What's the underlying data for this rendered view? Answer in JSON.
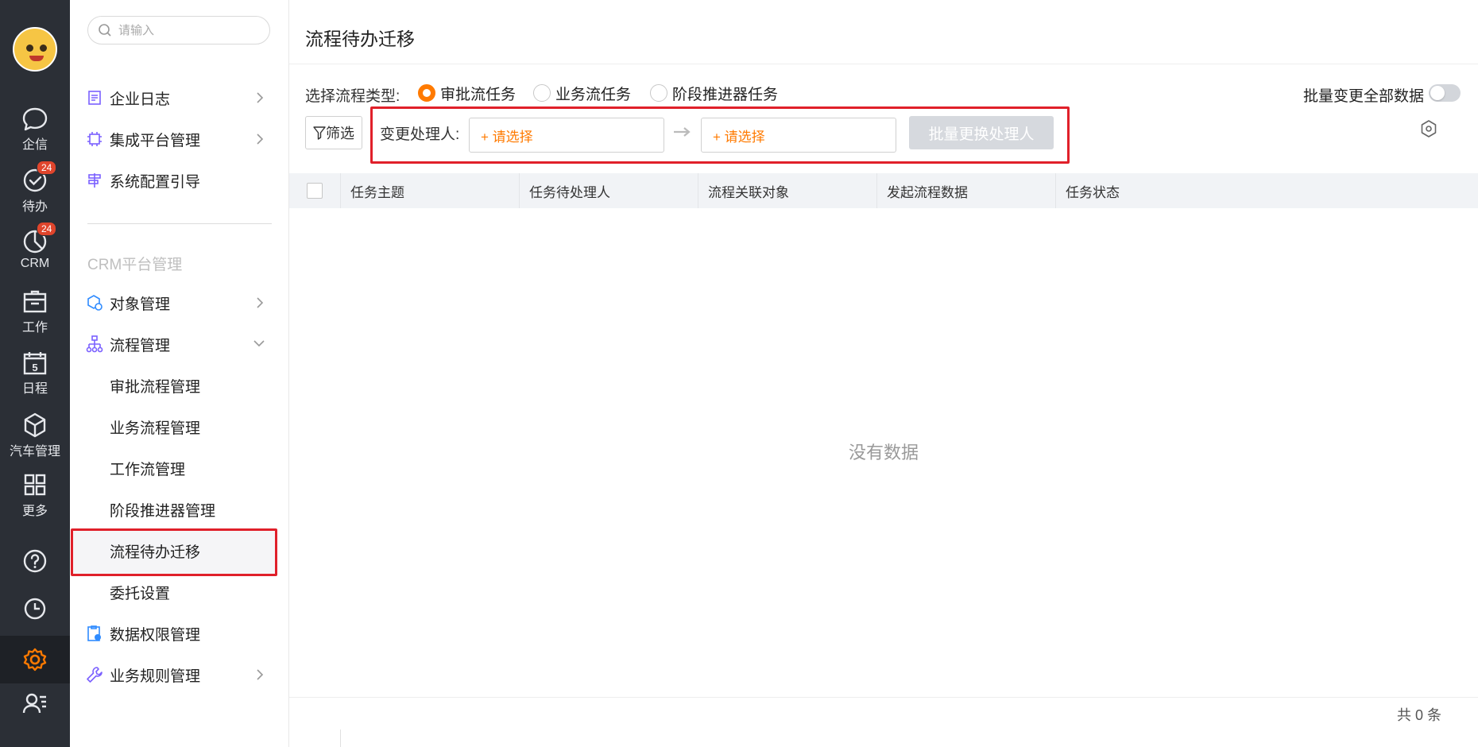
{
  "rail": {
    "items": [
      {
        "label": "企信",
        "icon": "chat-bubble-icon",
        "badge": ""
      },
      {
        "label": "待办",
        "icon": "check-circle-icon",
        "badge": "24"
      },
      {
        "label": "CRM",
        "icon": "pie-chart-icon",
        "badge": "24"
      },
      {
        "label": "工作",
        "icon": "briefcase-icon",
        "badge": ""
      },
      {
        "label": "日程",
        "icon": "calendar-icon",
        "badge": ""
      },
      {
        "label": "汽车管理",
        "icon": "cube-icon",
        "badge": ""
      },
      {
        "label": "更多",
        "icon": "grid-icon",
        "badge": ""
      }
    ],
    "calendar_day": "5",
    "bottom_icons": [
      "help-icon",
      "clock-icon",
      "settings-gear-icon",
      "user-card-icon"
    ],
    "active_color": "#ff7a00"
  },
  "menu": {
    "search_placeholder": "请输入",
    "items_top": [
      {
        "label": "企业日志",
        "icon": "journal-icon",
        "has_arrow": true
      },
      {
        "label": "集成平台管理",
        "icon": "chip-icon",
        "has_arrow": true
      },
      {
        "label": "系统配置引导",
        "icon": "signpost-icon",
        "has_arrow": false
      }
    ],
    "section_title": "CRM平台管理",
    "object_mgmt": "对象管理",
    "process_mgmt": "流程管理",
    "sub_items": [
      "审批流程管理",
      "业务流程管理",
      "工作流管理",
      "阶段推进器管理",
      "流程待办迁移",
      "委托设置"
    ],
    "data_perm": "数据权限管理",
    "biz_rules": "业务规则管理",
    "collapse_label": "«"
  },
  "main": {
    "title": "流程待办迁移",
    "type_label": "选择流程类型:",
    "radios": [
      "审批流任务",
      "业务流任务",
      "阶段推进器任务"
    ],
    "selected_radio": "审批流任务",
    "batch_all_label": "批量变更全部数据",
    "filter_label": "筛选",
    "change_label": "变更处理人:",
    "select_from": "+ 请选择",
    "select_to": "+ 请选择",
    "batch_button": "批量更换处理人",
    "columns": [
      "任务主题",
      "任务待处理人",
      "流程关联对象",
      "发起流程数据",
      "任务状态"
    ],
    "empty_text": "没有数据",
    "total_text": "共 0 条",
    "accent": "#ff7a00",
    "highlight": "#e0202a"
  }
}
